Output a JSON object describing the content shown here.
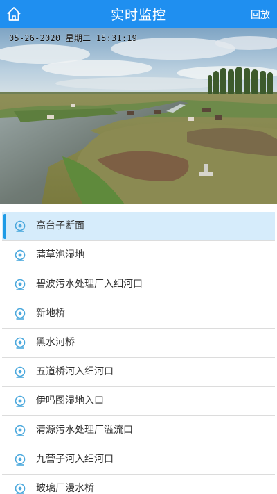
{
  "header": {
    "title": "实时监控",
    "playback_label": "回放",
    "home_icon": "home-icon"
  },
  "video": {
    "osd_timestamp": "05-26-2020 星期二 15:31:19"
  },
  "list": {
    "selected_index": 0,
    "item_icon": "camera-icon",
    "items": [
      {
        "label": "高台子断面"
      },
      {
        "label": "蒲草泡湿地"
      },
      {
        "label": "碧波污水处理厂入细河口"
      },
      {
        "label": "新地桥"
      },
      {
        "label": "黑水河桥"
      },
      {
        "label": "五道桥河入细河口"
      },
      {
        "label": "伊吗图湿地入口"
      },
      {
        "label": "清源污水处理厂溢流口"
      },
      {
        "label": "九营子河入细河口"
      },
      {
        "label": "玻璃厂漫水桥"
      }
    ]
  },
  "colors": {
    "header_bg": "#1f8ff0",
    "accent": "#1e9be6",
    "selected_bg": "#d6ecfb"
  }
}
